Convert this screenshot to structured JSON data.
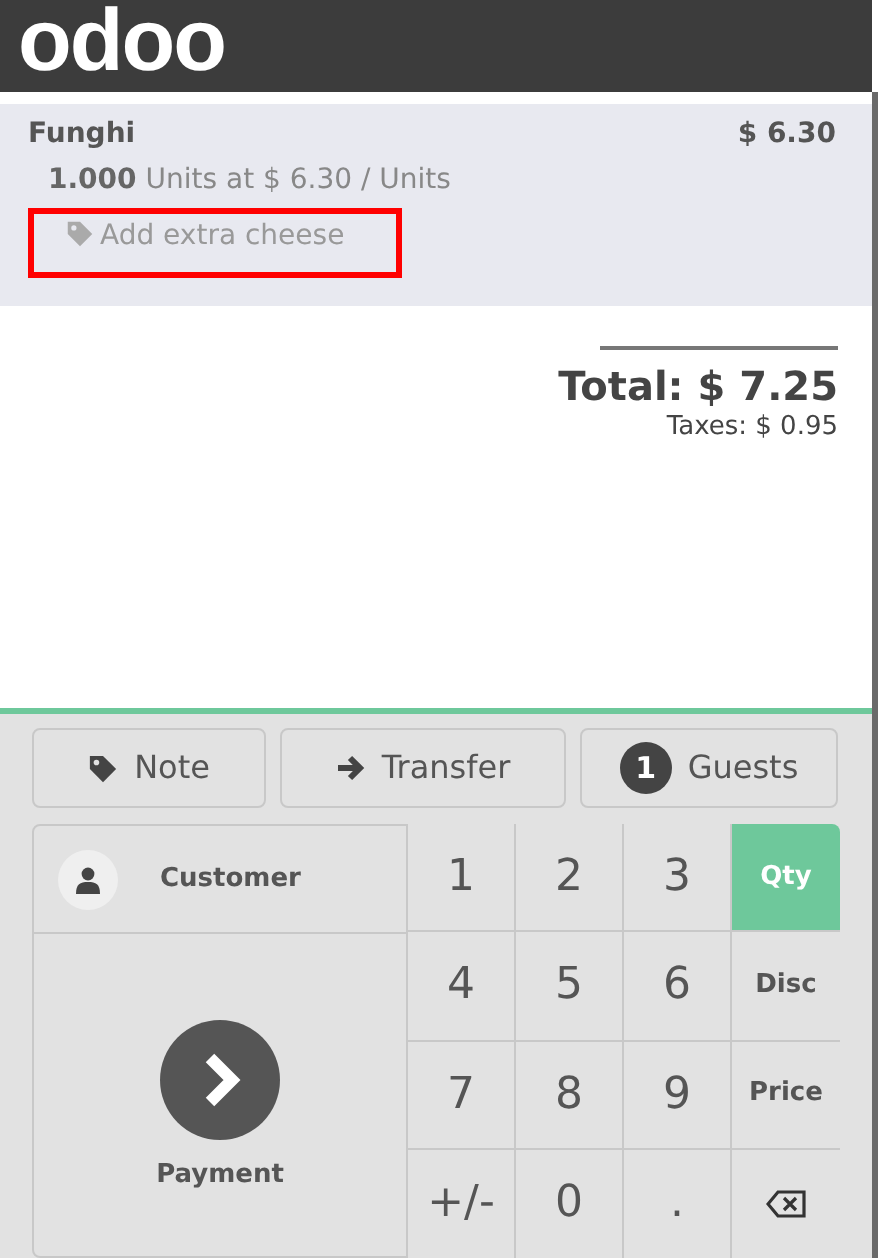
{
  "header": {
    "logo": "odoo"
  },
  "order_lines": [
    {
      "product": "Funghi",
      "price": "$ 6.30",
      "quantity": "1.000",
      "unit_info": "Units at $ 6.30 / Units",
      "note": "Add extra cheese",
      "highlighted": true,
      "selected": true
    }
  ],
  "summary": {
    "total": "Total: $ 7.25",
    "taxes": "Taxes: $ 0.95"
  },
  "actions": [
    {
      "kind": "note",
      "label": "Note"
    },
    {
      "kind": "transfer",
      "label": "Transfer"
    },
    {
      "kind": "guests",
      "count": "1",
      "label": "Guests"
    }
  ],
  "customer_button": {
    "label": "Customer"
  },
  "payment_button": {
    "label": "Payment"
  },
  "keypad": [
    {
      "kind": "digit",
      "label": "1"
    },
    {
      "kind": "digit",
      "label": "2"
    },
    {
      "kind": "digit",
      "label": "3"
    },
    {
      "kind": "mode",
      "label": "Qty",
      "selected": true
    },
    {
      "kind": "digit",
      "label": "4"
    },
    {
      "kind": "digit",
      "label": "5"
    },
    {
      "kind": "digit",
      "label": "6"
    },
    {
      "kind": "mode",
      "label": "Disc",
      "selected": false
    },
    {
      "kind": "digit",
      "label": "7"
    },
    {
      "kind": "digit",
      "label": "8"
    },
    {
      "kind": "digit",
      "label": "9"
    },
    {
      "kind": "mode",
      "label": "Price",
      "selected": false
    },
    {
      "kind": "digit",
      "label": "+/-"
    },
    {
      "kind": "digit",
      "label": "0"
    },
    {
      "kind": "digit",
      "label": "."
    },
    {
      "kind": "backspace"
    }
  ]
}
